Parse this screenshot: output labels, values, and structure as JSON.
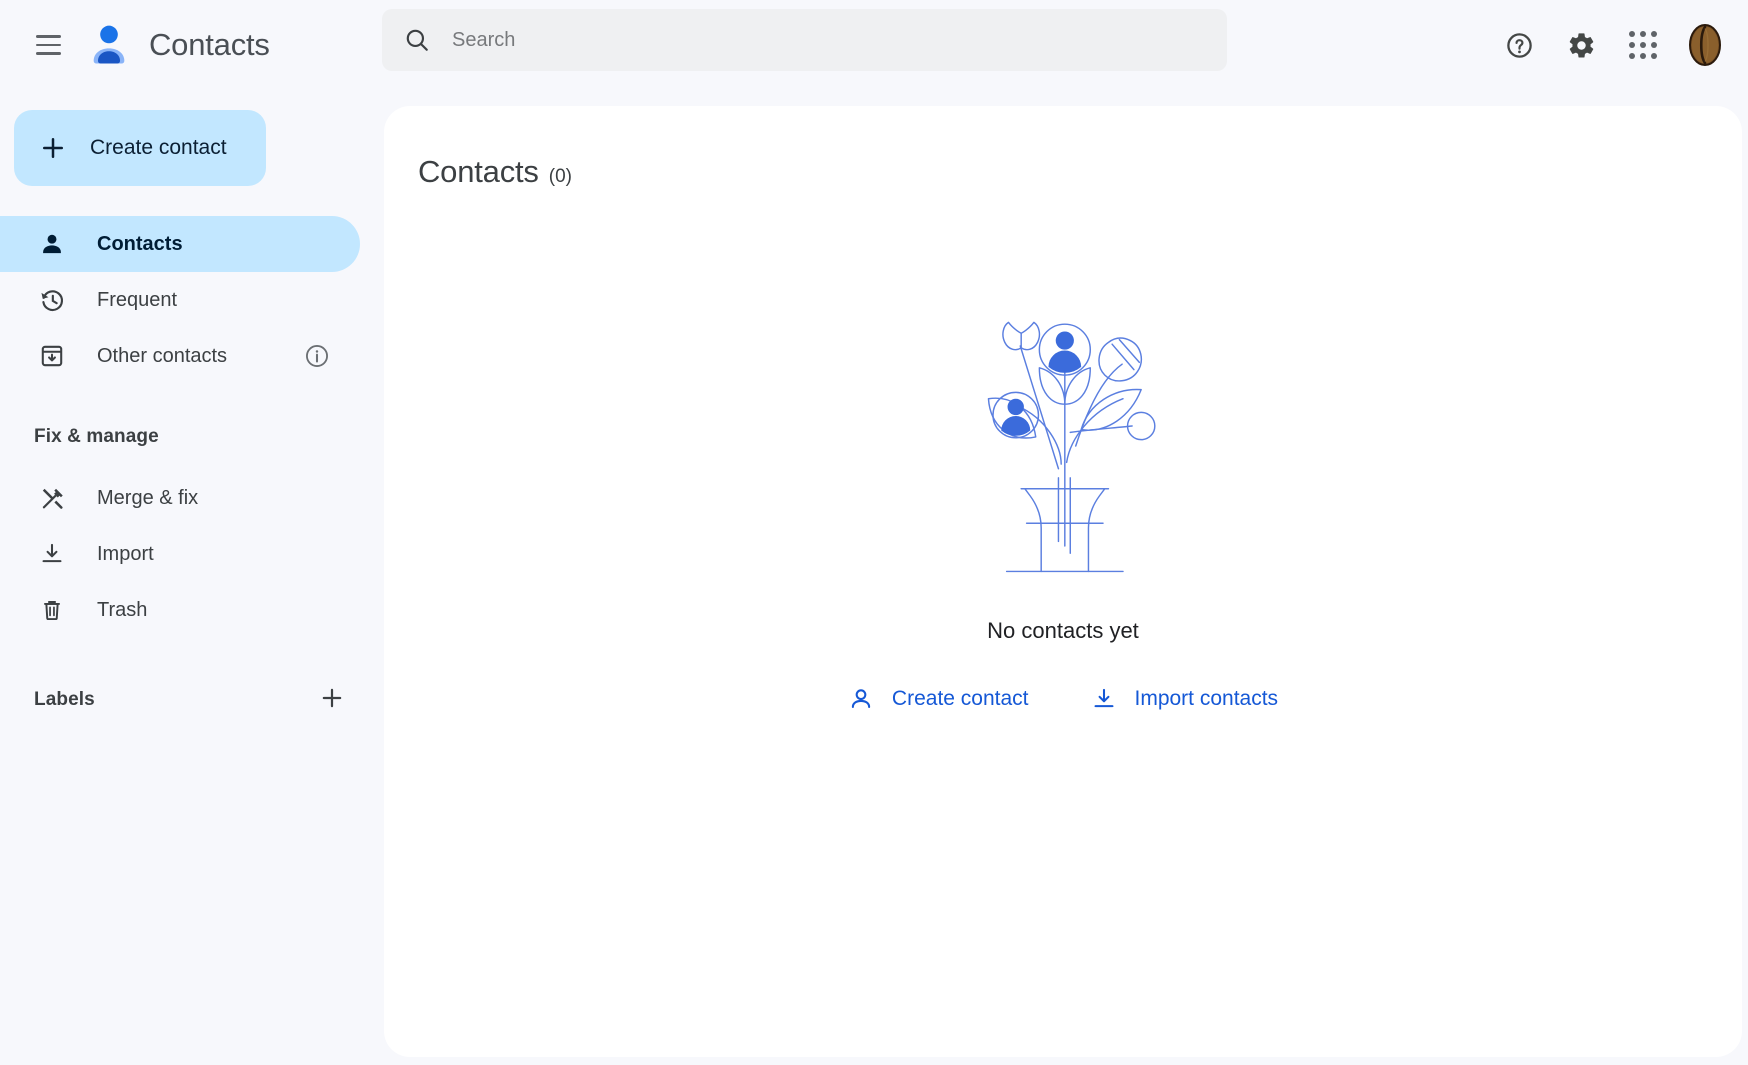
{
  "app": {
    "name": "Contacts",
    "accent_blue": "#1a73e8",
    "active_pill": "#c2e7ff",
    "panel_bg": "#ffffff",
    "page_bg": "#f7f8fc"
  },
  "topbar": {
    "menu_icon": "hamburger-menu-icon",
    "logo_icon": "contacts-person-logo",
    "title": "Contacts",
    "search": {
      "icon": "search-icon",
      "placeholder": "Search",
      "value": ""
    },
    "help_icon": "help-question-circle-icon",
    "settings_icon": "gear-settings-icon",
    "apps_icon": "google-apps-grid-icon",
    "avatar_icon": "coffee-bean-avatar"
  },
  "sidebar": {
    "create_button": {
      "label": "Create contact",
      "icon": "plus-icon"
    },
    "nav": [
      {
        "label": "Contacts",
        "icon": "person-icon",
        "active": true
      },
      {
        "label": "Frequent",
        "icon": "history-clock-icon",
        "active": false
      },
      {
        "label": "Other contacts",
        "icon": "inbox-download-icon",
        "active": false,
        "trailing_icon": "info-circle-icon"
      }
    ],
    "fix_manage": {
      "heading": "Fix & manage",
      "items": [
        {
          "label": "Merge & fix",
          "icon": "merge-tools-icon"
        },
        {
          "label": "Import",
          "icon": "import-download-icon"
        },
        {
          "label": "Trash",
          "icon": "trash-bin-icon"
        }
      ]
    },
    "labels": {
      "heading": "Labels",
      "add_icon": "plus-icon"
    }
  },
  "main": {
    "title": "Contacts",
    "count": "(0)",
    "empty_state": {
      "illustration": "flower-vase-contacts-illustration",
      "message": "No contacts yet",
      "actions": [
        {
          "label": "Create contact",
          "icon": "person-add-icon"
        },
        {
          "label": "Import contacts",
          "icon": "import-download-icon"
        }
      ]
    }
  }
}
